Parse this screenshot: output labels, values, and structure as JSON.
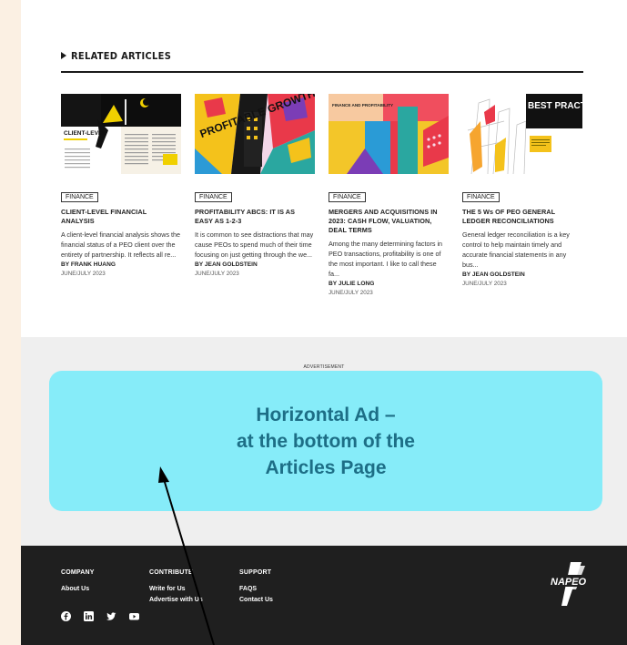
{
  "related": {
    "heading": "RELATED ARTICLES",
    "articles": [
      {
        "tag": "FINANCE",
        "title": "CLIENT-LEVEL FINANCIAL ANALYSIS",
        "description": "A client-level financial analysis shows the financial status of a PEO client over the entirety of partnership. It reflects all re...",
        "author": "BY FRANK HUANG",
        "date": "JUNE/JULY 2023",
        "thumb_text": "CLIENT-LEVEL"
      },
      {
        "tag": "FINANCE",
        "title": "PROFITABILITY ABCS: IT IS AS EASY AS 1-2-3",
        "description": "It is common to see distractions that may cause PEOs to spend much of their time focusing on just getting through the we...",
        "author": "BY JEAN GOLDSTEIN",
        "date": "JUNE/JULY 2023",
        "thumb_text": "PROFITABLE GROWTH"
      },
      {
        "tag": "FINANCE",
        "title": "MERGERS AND ACQUISITIONS IN 2023: CASH FLOW, VALUATION, DEAL TERMS",
        "description": "Among the many determining factors in PEO transactions, profitability is one of the most important. I like to call these fa...",
        "author": "BY JULIE LONG",
        "date": "JUNE/JULY 2023",
        "thumb_text": "FINANCE AND PROFITABILITY"
      },
      {
        "tag": "FINANCE",
        "title": "THE 5 Ws OF PEO GENERAL LEDGER RECONCILIATIONS",
        "description": "General ledger reconciliation is a key control to help maintain timely and accurate financial statements in any bus...",
        "author": "BY JEAN GOLDSTEIN",
        "date": "JUNE/JULY 2023",
        "thumb_text": "BEST PRACTICES"
      }
    ]
  },
  "ad": {
    "label": "ADVERTISEMENT",
    "line1": "Horizontal Ad –",
    "line2": "at the bottom of the",
    "line3": "Articles Page",
    "color": "#86ecf9"
  },
  "footer": {
    "company": {
      "heading": "COMPANY",
      "links": [
        "About Us"
      ]
    },
    "contribute": {
      "heading": "CONTRIBUTE",
      "links": [
        "Write for Us",
        "Advertise with Us"
      ]
    },
    "support": {
      "heading": "SUPPORT",
      "links": [
        "FAQS",
        "Contact Us"
      ]
    },
    "socials": [
      "facebook-icon",
      "linkedin-icon",
      "twitter-icon",
      "youtube-icon"
    ],
    "logo": "NAPEO"
  }
}
